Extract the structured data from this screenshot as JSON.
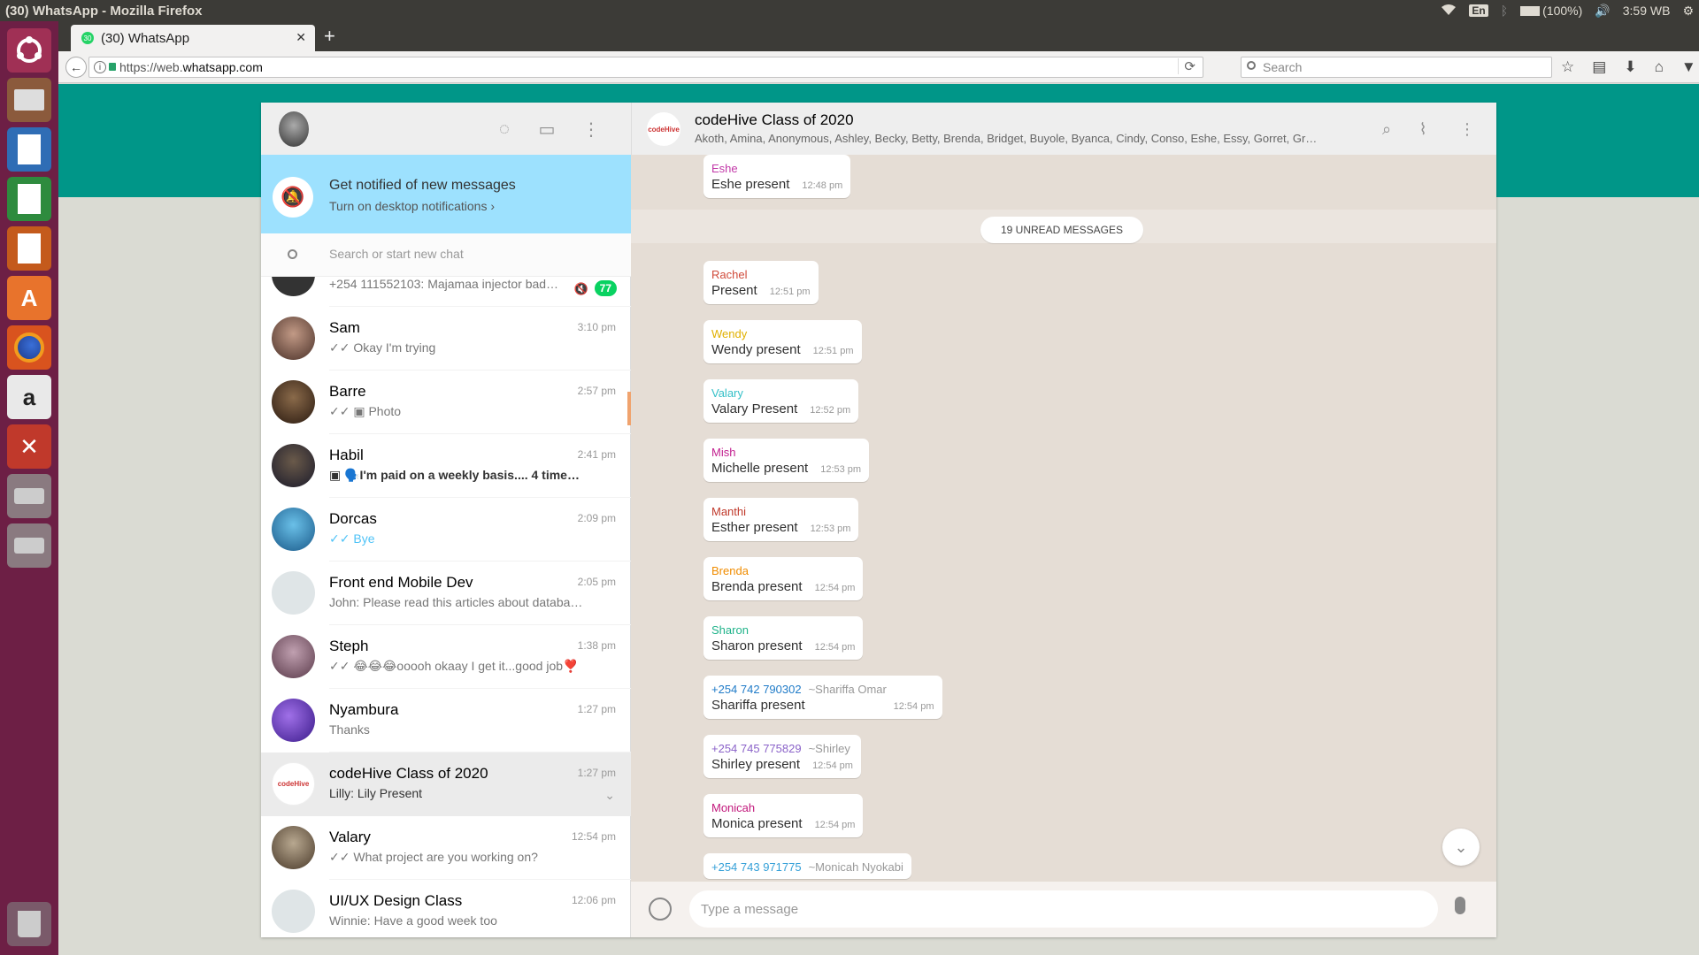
{
  "os": {
    "window_title": "(30) WhatsApp - Mozilla Firefox",
    "tray": {
      "lang": "En",
      "battery": "(100%)",
      "clock": "3:59 WB"
    }
  },
  "launcher": {
    "items": [
      "ubuntu-icon",
      "files-icon",
      "writer-icon",
      "calc-icon",
      "impress-icon",
      "software-center-icon",
      "firefox-icon",
      "amazon-icon",
      "settings-icon",
      "drive-icon",
      "drive2-icon",
      "trash-icon"
    ]
  },
  "browser": {
    "tab_title": "(30) WhatsApp",
    "tab_badge": "30",
    "url_prefix": "https://web.",
    "url_domain": "whatsapp.com",
    "search_placeholder": "Search"
  },
  "left": {
    "notify_title": "Get notified of new messages",
    "notify_sub": "Turn on desktop notifications ›",
    "search_placeholder": "Search or start new chat",
    "chats": [
      {
        "name": "",
        "time": "",
        "msg": "+254 111552103: Majamaa injector bad…",
        "badge": "77",
        "muted": true,
        "avatar": "#333333"
      },
      {
        "name": "Sam",
        "time": "3:10 pm",
        "msg": "✓✓ Okay I'm trying",
        "avatar": "#7a5b4a"
      },
      {
        "name": "Barre",
        "time": "2:57 pm",
        "msg": "✓✓ ▣ Photo",
        "avatar": "#5b4636"
      },
      {
        "name": "Habil",
        "time": "2:41 pm",
        "msg": "▣ 🗣️I'm paid on a weekly basis.... 4 times i…",
        "bold": true,
        "avatar": "#2d2d3a"
      },
      {
        "name": "Dorcas",
        "time": "2:09 pm",
        "msg": "✓✓ Bye",
        "avatar": "#3fa0d8"
      },
      {
        "name": "Front end Mobile Dev",
        "time": "2:05 pm",
        "msg": "John: Please read this articles about databases…",
        "avatar": "#dfe5e7",
        "group": true
      },
      {
        "name": "Steph",
        "time": "1:38 pm",
        "msg": "✓✓ 😂😂😂ooooh okaay I get it...good job❣️",
        "avatar": "#8a6a7a"
      },
      {
        "name": "Nyambura",
        "time": "1:27 pm",
        "msg": "Thanks",
        "avatar": "#6a3fc8"
      },
      {
        "name": "codeHive Class of 2020",
        "time": "1:27 pm",
        "msg": "Lilly: Lily Present",
        "active": true,
        "avatar": "#ffffff"
      },
      {
        "name": "Valary",
        "time": "12:54 pm",
        "msg": "✓✓ What project are you working on?",
        "avatar": "#8b7d6b"
      },
      {
        "name": "UI/UX Design Class",
        "time": "12:06 pm",
        "msg": "Winnie: Have a good week too",
        "avatar": "#dfe5e7",
        "group": true
      }
    ]
  },
  "right": {
    "group_name": "codeHive Class of 2020",
    "group_logo_text": "codeHive",
    "members": "Akoth, Amina, Anonymous, Ashley, Becky, Betty, Brenda, Bridget, Buyole, Byanca, Cindy, Conso, Eshe, Essy, Gorret, Gr…",
    "unread_label": "19 UNREAD MESSAGES",
    "messages": [
      {
        "sender": "Eshe",
        "color": "#c238a8",
        "text": "Eshe present",
        "time": "12:48 pm"
      },
      {
        "sender": "Rachel",
        "color": "#d04a3a",
        "text": "Present",
        "time": "12:51 pm"
      },
      {
        "sender": "Wendy",
        "color": "#e0b000",
        "text": "Wendy present",
        "time": "12:51 pm"
      },
      {
        "sender": "Valary",
        "color": "#35c0c8",
        "text": "Valary Present",
        "time": "12:52 pm"
      },
      {
        "sender": "Mish",
        "color": "#c21f8f",
        "text": "Michelle present",
        "time": "12:53 pm"
      },
      {
        "sender": "Manthi",
        "color": "#c0392b",
        "text": "Esther present",
        "time": "12:53 pm"
      },
      {
        "sender": "Brenda",
        "color": "#f08c00",
        "text": "Brenda present",
        "time": "12:54 pm"
      },
      {
        "sender": "Sharon",
        "color": "#20b38a",
        "text": "Sharon present",
        "time": "12:54 pm"
      },
      {
        "sender": "+254 742 790302",
        "alias": "~Shariffa Omar",
        "color": "#1f7bc8",
        "text": "Shariffa present",
        "time": "12:54 pm"
      },
      {
        "sender": "+254 745 775829",
        "alias": "~Shirley",
        "color": "#8b63c9",
        "text": "Shirley present",
        "time": "12:54 pm"
      },
      {
        "sender": "Monicah",
        "color": "#c2187c",
        "text": "Monica present",
        "time": "12:54 pm"
      },
      {
        "sender": "+254 743 971775",
        "alias": "~Monicah Nyokabi",
        "color": "#35a0d8",
        "text": "",
        "time": ""
      }
    ],
    "composer_placeholder": "Type a message"
  }
}
